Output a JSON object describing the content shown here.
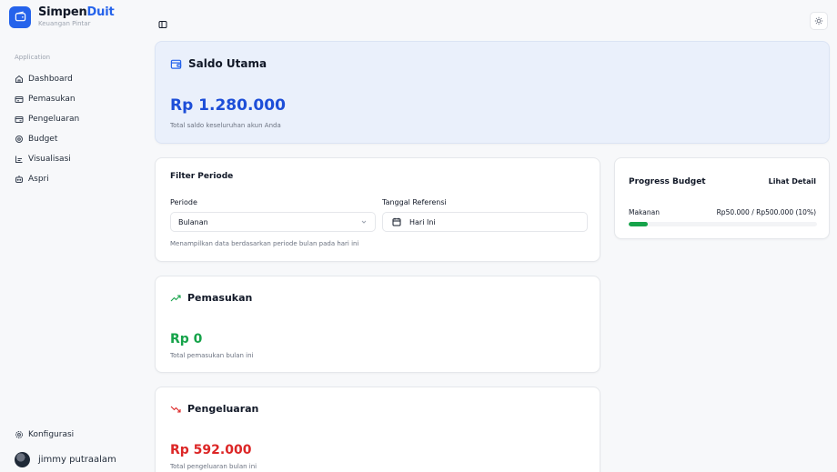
{
  "brand": {
    "name_main": "Simpen",
    "name_accent": "Duit",
    "subtitle": "Keuangan Pintar",
    "accent_color": "#2563eb"
  },
  "sidebar": {
    "group_label": "Application",
    "items": [
      {
        "label": "Dashboard",
        "icon": "home-icon"
      },
      {
        "label": "Pemasukan",
        "icon": "wallet-in-icon"
      },
      {
        "label": "Pengeluaran",
        "icon": "wallet-out-icon"
      },
      {
        "label": "Budget",
        "icon": "settings-budget-icon"
      },
      {
        "label": "Visualisasi",
        "icon": "chart-icon"
      },
      {
        "label": "Aspri",
        "icon": "assistant-icon"
      }
    ],
    "settings_label": "Konfigurasi",
    "user_name": "jimmy putraalam"
  },
  "saldo": {
    "title": "Saldo Utama",
    "amount": "Rp 1.280.000",
    "description": "Total saldo keseluruhan akun Anda",
    "color": "#1d4ed8"
  },
  "filter": {
    "title": "Filter Periode",
    "period_label": "Periode",
    "period_value": "Bulanan",
    "reference_label": "Tanggal Referensi",
    "reference_value": "Hari Ini",
    "note": "Menampilkan data berdasarkan periode bulan pada hari ini"
  },
  "budget": {
    "title": "Progress Budget",
    "detail_link": "Lihat Detail",
    "items": [
      {
        "category": "Makanan",
        "value": "Rp50.000 / Rp500.000 (10%)",
        "progress": 0.1
      }
    ],
    "bar_color": "#16a34a"
  },
  "income": {
    "title": "Pemasukan",
    "amount": "Rp 0",
    "description": "Total pemasukan bulan ini",
    "color": "#16a34a"
  },
  "expense": {
    "title": "Pengeluaran",
    "amount": "Rp 592.000",
    "description": "Total pengeluaran bulan ini",
    "color": "#dc2626"
  }
}
